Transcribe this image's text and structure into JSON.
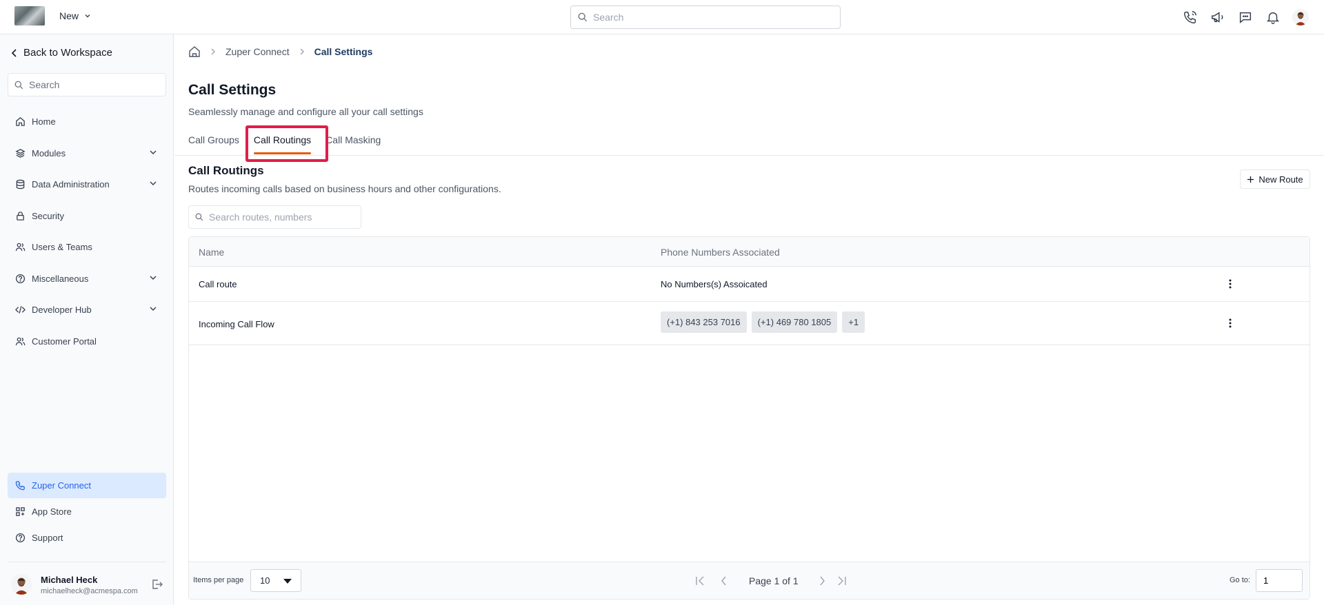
{
  "topbar": {
    "new_label": "New",
    "search_placeholder": "Search"
  },
  "sidebar": {
    "back_label": "Back to Workspace",
    "search_placeholder": "Search",
    "items": [
      {
        "label": "Home",
        "icon": "home-icon"
      },
      {
        "label": "Modules",
        "icon": "layers-icon",
        "expandable": true
      },
      {
        "label": "Data Administration",
        "icon": "database-icon",
        "expandable": true
      },
      {
        "label": "Security",
        "icon": "lock-icon"
      },
      {
        "label": "Users & Teams",
        "icon": "users-icon"
      },
      {
        "label": "Miscellaneous",
        "icon": "help-circle-icon",
        "expandable": true
      },
      {
        "label": "Developer Hub",
        "icon": "code-icon",
        "expandable": true
      },
      {
        "label": "Customer Portal",
        "icon": "users-icon"
      }
    ],
    "bottom_items": [
      {
        "label": "Zuper Connect",
        "icon": "phone-icon",
        "active": true
      },
      {
        "label": "App Store",
        "icon": "apps-icon"
      },
      {
        "label": "Support",
        "icon": "help-circle-icon"
      }
    ],
    "user": {
      "name": "Michael Heck",
      "email": "michaelheck@acmespa.com"
    }
  },
  "breadcrumb": {
    "items": [
      "Zuper Connect",
      "Call Settings"
    ]
  },
  "page": {
    "title": "Call Settings",
    "subtitle": "Seamlessly manage and configure all your call settings",
    "tabs": [
      {
        "label": "Call Groups",
        "active": false
      },
      {
        "label": "Call Routings",
        "active": true
      },
      {
        "label": "Call Masking",
        "active": false
      }
    ]
  },
  "section": {
    "title": "Call Routings",
    "subtitle": "Routes incoming calls based on business hours and other configurations.",
    "new_button": "New Route",
    "search_placeholder": "Search routes, numbers"
  },
  "table": {
    "columns": [
      "Name",
      "Phone Numbers Associated"
    ],
    "rows": [
      {
        "name": "Call route",
        "numbers_text": "No Numbers(s) Assoicated",
        "chips": []
      },
      {
        "name": "Incoming Call Flow",
        "numbers_text": "",
        "chips": [
          "(+1) 843 253 7016",
          "(+1) 469 780 1805",
          "+1"
        ]
      }
    ]
  },
  "pagination": {
    "items_per_page_label": "Items per page",
    "items_per_page": "10",
    "page_text": "Page 1 of 1",
    "goto_label": "Go to:",
    "goto_value": "1"
  },
  "colors": {
    "accent": "#ea580c",
    "highlight": "#e11d48",
    "active_nav_bg": "#dbeafe",
    "active_nav_text": "#2563eb"
  }
}
